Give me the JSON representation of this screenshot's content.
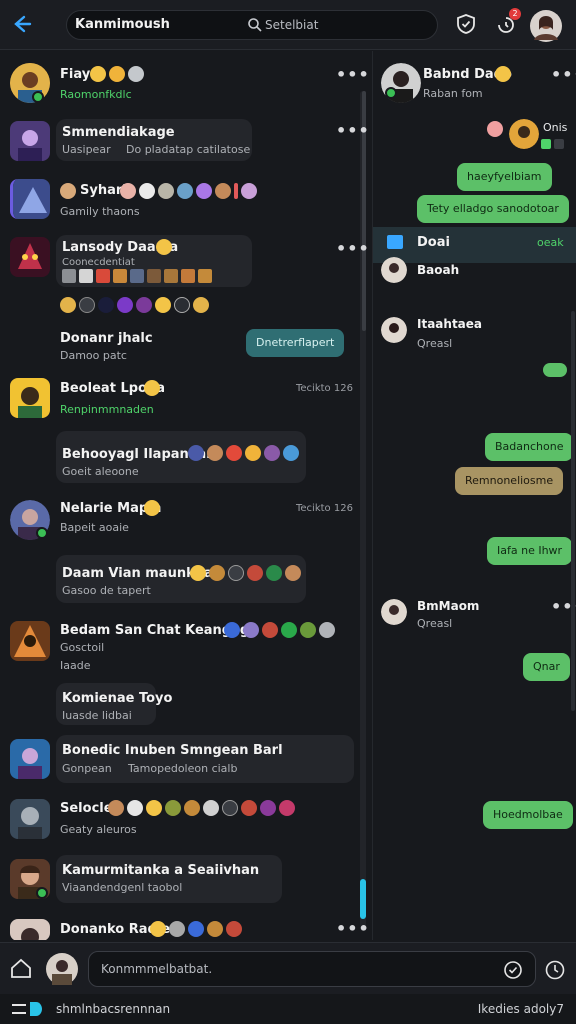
{
  "topbar": {
    "title": "Kanmimoush",
    "search_placeholder": "Setelbiat",
    "notification_count": "2"
  },
  "left": {
    "chats": [
      {
        "name": "Fiay",
        "sub": "Raomonfkdlc",
        "sub_green": true
      },
      {
        "name": "Smmendiakage",
        "sub": "Uasipear",
        "sub2": "Do pladatap catilatose"
      },
      {
        "name": "Syhari",
        "sub": "Gamily thaons"
      },
      {
        "name": "Lansody Daania",
        "sub": "Coonecdentiat"
      },
      {
        "name": "Donanr jhalc",
        "sub": "Damoo patc"
      },
      {
        "name": "Beoleat Lpoda",
        "sub": "Renpinmmnaden",
        "sub_green": true,
        "time": "Tecikto 126"
      },
      {
        "name": "Behooyagl Ilapankari",
        "sub": "Goeit aleoone"
      },
      {
        "name": "Nelarie Mapla",
        "sub": "Bapeit aoaie",
        "time": "Tecikto 126"
      },
      {
        "name": "Daam Vian maunkgan",
        "sub": "Gasoo de tapert"
      },
      {
        "name": "Bedam San Chat Keangagh",
        "sub": "Gosctoil",
        "sub2": "Iaade"
      },
      {
        "name": "Komienae Toyo",
        "sub": "Iuasde lidbai"
      },
      {
        "name": "Bonedic Inuben Smngean Barl",
        "sub": "Gonpean",
        "sub2": "Tamopedoleon cialb"
      },
      {
        "name": "Seloclel",
        "sub": "Geaty aleuros"
      },
      {
        "name": "Kamurmitanka a Seaiivhan",
        "sub": "Viaandendgenl taobol"
      },
      {
        "name": "Donanko Radie"
      }
    ],
    "reply_pill": "Dnetrerflapert"
  },
  "right": {
    "header_name": "Babnd Dado",
    "header_sub": "Raban fom",
    "top_label": "Onis",
    "pill1": "haeyfyelbiam",
    "pill2": "Tety elladgo sanodotoar",
    "highlight_name": "Doai",
    "highlight_right": "oeak",
    "p1_name": "Baoah",
    "p2_name": "Itaahtaea",
    "p2_sub": "Qreasl",
    "pill3": "Badanchone",
    "pill4": "Remnoneliosme",
    "pill5": "Iafa ne Ihwr",
    "p3_name": "BmMaom",
    "p3_sub": "Qreasl",
    "pill6": "Qnar",
    "pill7": "Hoedmolbae",
    "colors": {
      "accent": "#39a7ff",
      "bubble_green": "#5cc068",
      "bubble_tan": "#a89463"
    }
  },
  "composer": {
    "placeholder": "Konmmmelbatbat."
  },
  "statusbar": {
    "left": "shmlnbacsrennnan",
    "right": "Ikedies adoly7"
  }
}
